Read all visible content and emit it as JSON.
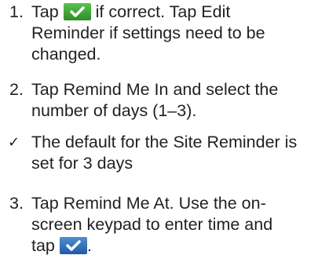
{
  "steps": [
    {
      "number": "1.",
      "lines": [
        {
          "pre": "Tap",
          "icon": "green-checkmark-button-icon",
          "post": "if correct. Tap Edit"
        },
        {
          "text": "Reminder if settings need to be"
        },
        {
          "text": "changed."
        }
      ]
    },
    {
      "number": "2.",
      "lines": [
        {
          "text": "Tap Remind Me In and select the"
        },
        {
          "text": "number of days (1–3)."
        }
      ]
    },
    {
      "note_marker": "✓",
      "lines": [
        {
          "text": "The default for the Site Reminder is"
        },
        {
          "text": "set for 3 days"
        }
      ]
    },
    {
      "number": "3.",
      "lines": [
        {
          "text": "Tap Remind Me At. Use the on-"
        },
        {
          "text": "screen keypad to enter time and"
        },
        {
          "pre": "tap",
          "icon": "blue-checkmark-button-icon",
          "post": "."
        }
      ]
    }
  ],
  "colors": {
    "text": "#231f20",
    "green_button": "#3ea83a",
    "blue_button": "#2c6db5"
  }
}
